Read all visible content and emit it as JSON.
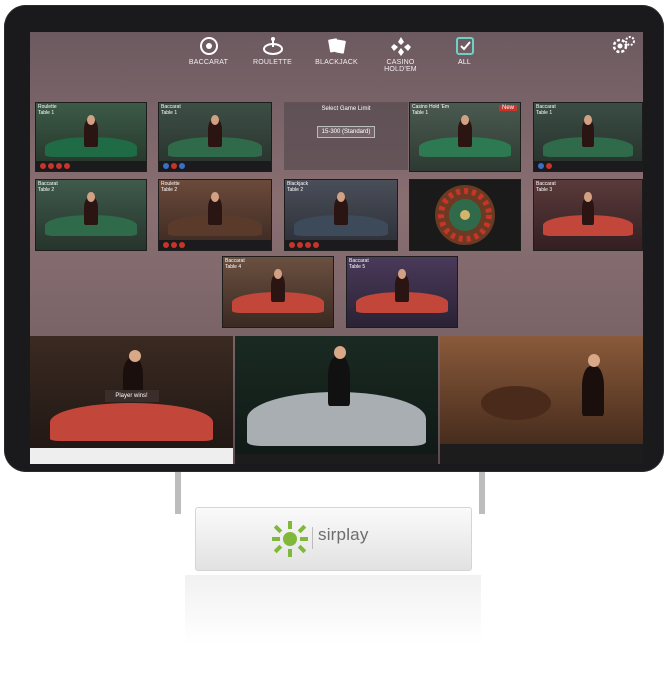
{
  "nav": {
    "tabs": [
      {
        "label": "BACCARAT",
        "icon": "baccarat-icon"
      },
      {
        "label": "ROULETTE",
        "icon": "roulette-icon"
      },
      {
        "label": "BLACKJACK",
        "icon": "blackjack-icon"
      },
      {
        "label": "CASINO HOLD'EM",
        "icon": "casino-holdem-icon"
      },
      {
        "label": "ALL",
        "icon": "all-checkbox-icon"
      }
    ],
    "settings_icon": "gear-icon"
  },
  "tiles": [
    {
      "title": "Roulette",
      "sub": "Table 1"
    },
    {
      "title": "Baccarat",
      "sub": "Table 1"
    },
    {
      "title": "Casino Hold 'Em",
      "sub": "Table 1",
      "badge": "New"
    },
    {
      "title": "Baccarat",
      "sub": "Table 1"
    },
    {
      "title": "Baccarat",
      "sub": "Table 2"
    },
    {
      "title": "Roulette",
      "sub": "Table 2"
    },
    {
      "title": "Blackjack",
      "sub": "Table 2"
    },
    {
      "title": "Baccarat",
      "sub": "Table 3"
    },
    {
      "title": "Baccarat",
      "sub": "Table 4"
    },
    {
      "title": "Baccarat",
      "sub": "Table 5"
    }
  ],
  "limit_popup": {
    "heading": "Select Game Limit",
    "value": "15-300 (Standard)"
  },
  "featured": {
    "player_wins": "Player wins!"
  },
  "brand": {
    "name": "sirplay"
  },
  "colors": {
    "accent": "#c7342a",
    "brand_green": "#7fb83a",
    "felt_green": "#2f6b4a",
    "felt_red": "#c2473a"
  }
}
